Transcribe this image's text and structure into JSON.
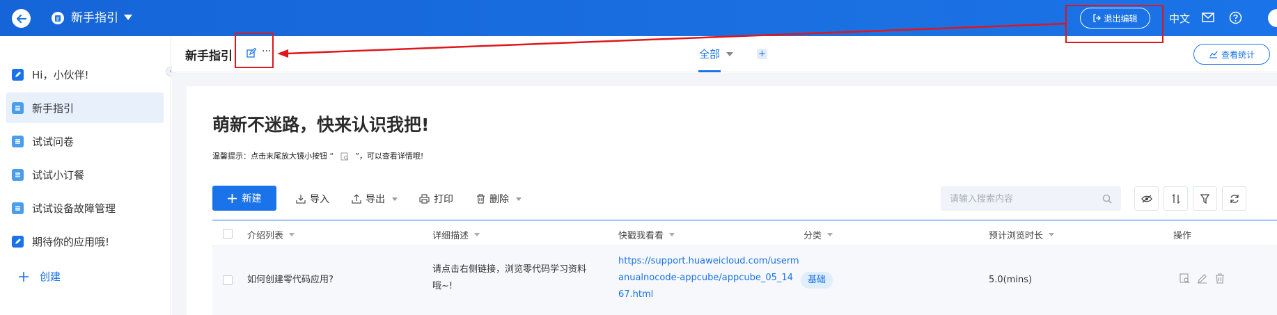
{
  "topbar": {
    "app_title": "新手指引",
    "exit_edit_label": "退出编辑",
    "language": "中文"
  },
  "sidebar": {
    "items": [
      {
        "label": "Hi，小伙伴!",
        "icon": "form-icon",
        "active": false
      },
      {
        "label": "新手指引",
        "icon": "list-icon",
        "active": true
      },
      {
        "label": "试试问卷",
        "icon": "list-icon",
        "active": false
      },
      {
        "label": "试试小订餐",
        "icon": "list-icon",
        "active": false
      },
      {
        "label": "试试设备故障管理",
        "icon": "list-icon",
        "active": false
      },
      {
        "label": "期待你的应用哦!",
        "icon": "form-icon",
        "active": false
      }
    ],
    "create_label": "创建"
  },
  "pagebar": {
    "title": "新手指引",
    "more": "···",
    "tab_all": "全部",
    "add_tab": "+",
    "stats_label": "查看统计"
  },
  "content": {
    "headline": "萌新不迷路，快来认识我把!",
    "tip_prefix": "温馨提示：点击末尾放大镜小按钮 “",
    "tip_suffix": "”，可以查看详情哦!"
  },
  "toolbar": {
    "new_label": "新建",
    "import_label": "导入",
    "export_label": "导出",
    "print_label": "打印",
    "delete_label": "删除",
    "search_placeholder": "请输入搜索内容"
  },
  "table": {
    "columns": [
      "介绍列表",
      "详细描述",
      "快戳我看看",
      "分类",
      "预计浏览时长",
      "操作"
    ],
    "rows": [
      {
        "intro": "如何创建零代码应用?",
        "desc_line1": "请点击右侧链接，浏览零代码学习资料",
        "desc_line2": "哦~!",
        "link_line1": "https://support.huaweicloud.com/userm",
        "link_line2": "anualnocode-appcube/appcube_05_14",
        "link_line3": "67.html",
        "category": "基础",
        "duration": "5.0(mins)"
      }
    ]
  },
  "colors": {
    "brand_blue": "#1a73e8",
    "annotation_red": "#e0161b"
  }
}
